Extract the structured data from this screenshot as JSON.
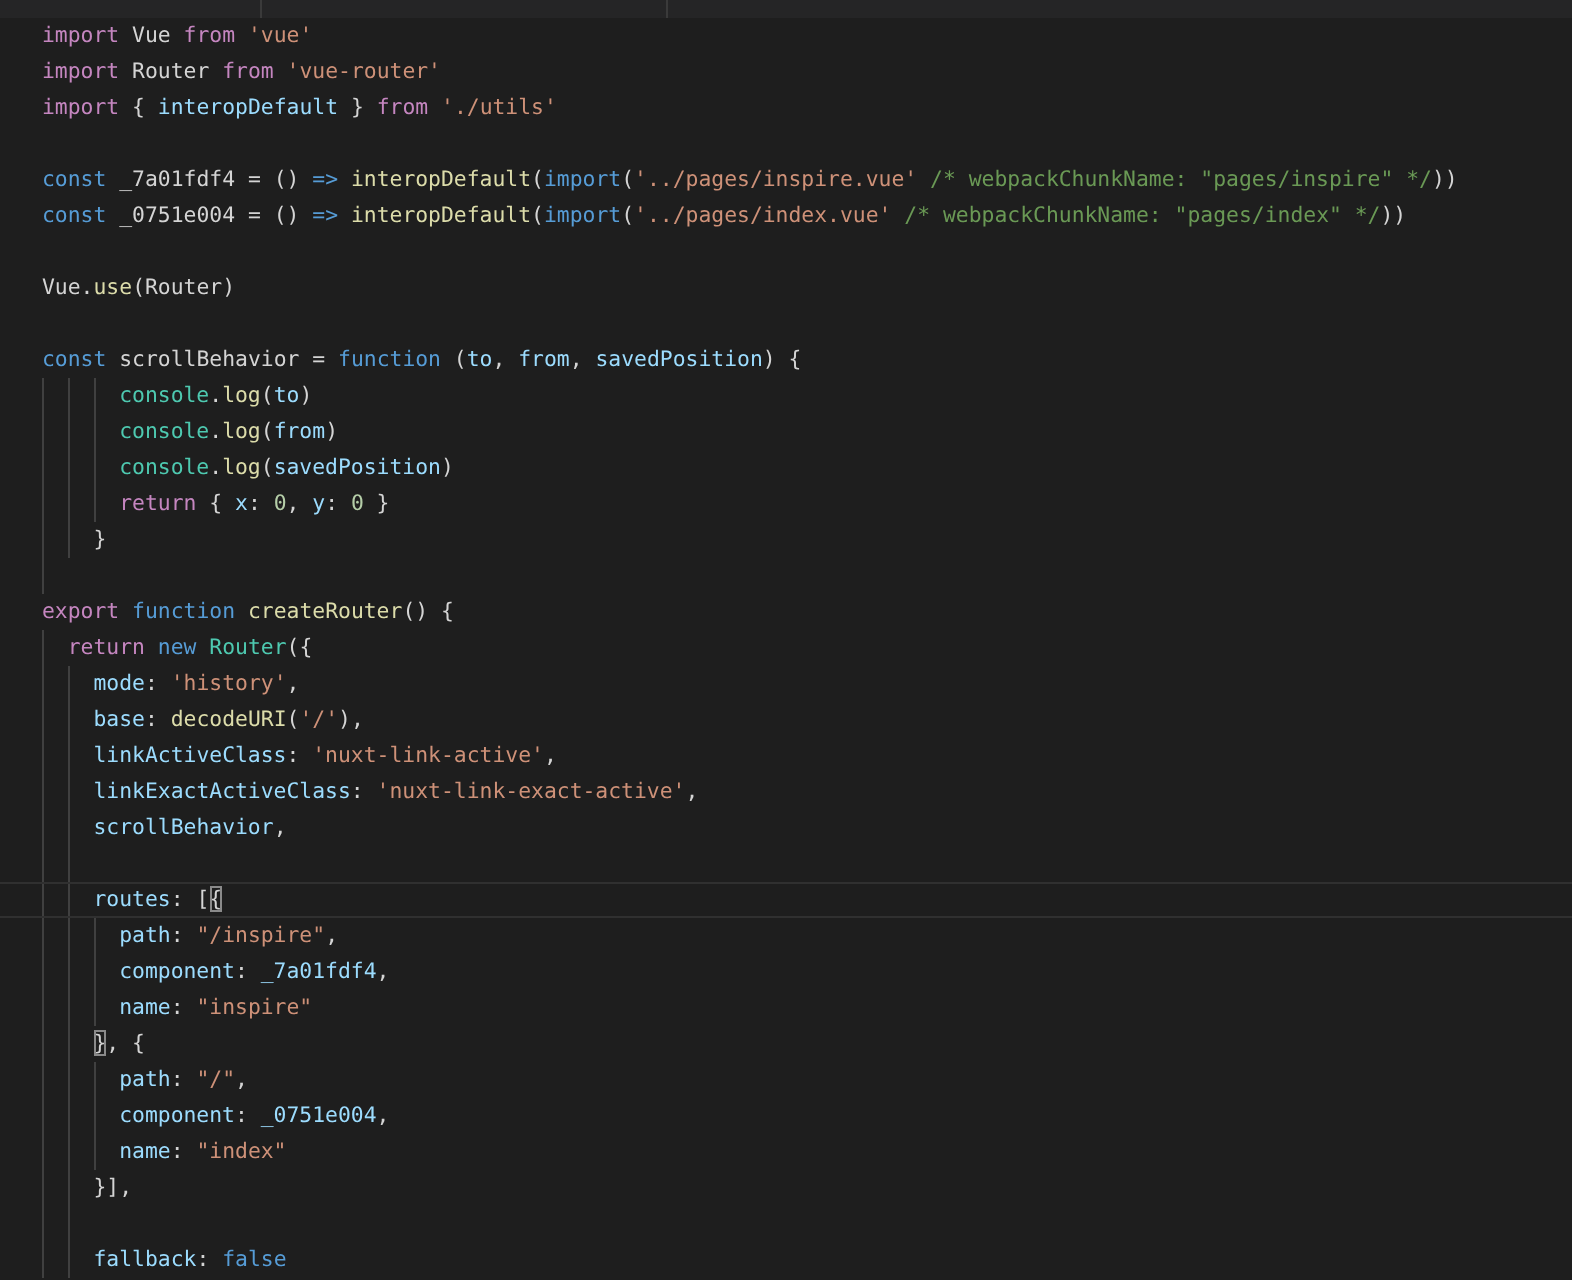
{
  "editor": {
    "lines": [
      {
        "kind": "flush",
        "current": false,
        "tokens": [
          {
            "t": "import",
            "kind": "keyword"
          },
          {
            "t": " Vue ",
            "kind": "plain"
          },
          {
            "t": "from",
            "kind": "keyword"
          },
          {
            "t": " 'vue'",
            "kind": "string"
          }
        ]
      },
      {
        "kind": "flush",
        "current": false,
        "tokens": [
          {
            "t": "import",
            "kind": "keyword"
          },
          {
            "t": " Router ",
            "kind": "plain"
          },
          {
            "t": "from",
            "kind": "keyword"
          },
          {
            "t": " 'vue-router'",
            "kind": "string"
          }
        ]
      },
      {
        "kind": "flush",
        "current": false,
        "tokens": [
          {
            "t": "import",
            "kind": "keyword"
          },
          {
            "t": " { ",
            "kind": "plain"
          },
          {
            "t": "interopDefault",
            "kind": "variable"
          },
          {
            "t": " } ",
            "kind": "plain"
          },
          {
            "t": "from",
            "kind": "keyword"
          },
          {
            "t": " './utils'",
            "kind": "string"
          }
        ]
      },
      {
        "kind": "flush",
        "current": false
      },
      {
        "kind": "flush",
        "current": false,
        "tokens": [
          {
            "t": "const",
            "kind": "storage"
          },
          {
            "t": " _7a01fdf4 = () ",
            "kind": "plain"
          },
          {
            "t": "=>",
            "kind": "storage"
          },
          {
            "t": " interopDefault",
            "kind": "function"
          },
          {
            "t": "(",
            "kind": "plain"
          },
          {
            "t": "import",
            "kind": "storage"
          },
          {
            "t": "(",
            "kind": "plain"
          },
          {
            "t": "'../pages/inspire.vue'",
            "kind": "string"
          },
          {
            "t": " /* webpackChunkName: \"pages/inspire\" */",
            "kind": "comment"
          },
          {
            "t": "))",
            "kind": "plain"
          }
        ]
      },
      {
        "kind": "flush",
        "current": false,
        "tokens": [
          {
            "t": "const",
            "kind": "storage"
          },
          {
            "t": " _0751e004 = () ",
            "kind": "plain"
          },
          {
            "t": "=>",
            "kind": "storage"
          },
          {
            "t": " interopDefault",
            "kind": "function"
          },
          {
            "t": "(",
            "kind": "plain"
          },
          {
            "t": "import",
            "kind": "storage"
          },
          {
            "t": "(",
            "kind": "plain"
          },
          {
            "t": "'../pages/index.vue'",
            "kind": "string"
          },
          {
            "t": " /* webpackChunkName: \"pages/index\" */",
            "kind": "comment"
          },
          {
            "t": "))",
            "kind": "plain"
          }
        ]
      },
      {
        "kind": "flush",
        "current": false
      },
      {
        "kind": "flush",
        "current": false,
        "tokens": [
          {
            "t": "Vue.",
            "kind": "plain"
          },
          {
            "t": "use",
            "kind": "function"
          },
          {
            "t": "(Router)",
            "kind": "plain"
          }
        ]
      },
      {
        "kind": "flush",
        "current": false
      },
      {
        "kind": "flush",
        "current": false,
        "tokens": [
          {
            "t": "const",
            "kind": "storage"
          },
          {
            "t": " scrollBehavior = ",
            "kind": "plain"
          },
          {
            "t": "function",
            "kind": "storage"
          },
          {
            "t": " (",
            "kind": "plain"
          },
          {
            "t": "to",
            "kind": "variable"
          },
          {
            "t": ", ",
            "kind": "plain"
          },
          {
            "t": "from",
            "kind": "variable"
          },
          {
            "t": ", ",
            "kind": "plain"
          },
          {
            "t": "savedPosition",
            "kind": "variable"
          },
          {
            "t": ") {",
            "kind": "plain"
          }
        ]
      },
      {
        "kind": "deep",
        "current": false,
        "tokens": [
          {
            "t": "console",
            "kind": "type"
          },
          {
            "t": ".",
            "kind": "plain"
          },
          {
            "t": "log",
            "kind": "function"
          },
          {
            "t": "(",
            "kind": "plain"
          },
          {
            "t": "to",
            "kind": "variable"
          },
          {
            "t": ")",
            "kind": "plain"
          }
        ]
      },
      {
        "kind": "deep",
        "current": false,
        "tokens": [
          {
            "t": "console",
            "kind": "type"
          },
          {
            "t": ".",
            "kind": "plain"
          },
          {
            "t": "log",
            "kind": "function"
          },
          {
            "t": "(",
            "kind": "plain"
          },
          {
            "t": "from",
            "kind": "variable"
          },
          {
            "t": ")",
            "kind": "plain"
          }
        ]
      },
      {
        "kind": "deep",
        "current": false,
        "tokens": [
          {
            "t": "console",
            "kind": "type"
          },
          {
            "t": ".",
            "kind": "plain"
          },
          {
            "t": "log",
            "kind": "function"
          },
          {
            "t": "(",
            "kind": "plain"
          },
          {
            "t": "savedPosition",
            "kind": "variable"
          },
          {
            "t": ")",
            "kind": "plain"
          }
        ]
      },
      {
        "kind": "deep",
        "current": false,
        "tokens": [
          {
            "t": "return",
            "kind": "keyword"
          },
          {
            "t": " { ",
            "kind": "plain"
          },
          {
            "t": "x",
            "kind": "variable"
          },
          {
            "t": ": ",
            "kind": "plain"
          },
          {
            "t": "0",
            "kind": "number"
          },
          {
            "t": ", ",
            "kind": "plain"
          },
          {
            "t": "y",
            "kind": "variable"
          },
          {
            "t": ": ",
            "kind": "plain"
          },
          {
            "t": "0",
            "kind": "number"
          },
          {
            "t": " }",
            "kind": "plain"
          }
        ]
      },
      {
        "kind": "middle",
        "current": false,
        "tokens": [
          {
            "t": "}",
            "kind": "plain"
          }
        ]
      },
      {
        "kind": "shallow",
        "current": false
      },
      {
        "kind": "flush",
        "current": false,
        "tokens": [
          {
            "t": "export",
            "kind": "keyword"
          },
          {
            "t": " function",
            "kind": "storage"
          },
          {
            "t": " createRouter",
            "kind": "function"
          },
          {
            "t": "() {",
            "kind": "plain"
          }
        ]
      },
      {
        "kind": "shallow",
        "current": false,
        "tokens": [
          {
            "t": "return",
            "kind": "keyword"
          },
          {
            "t": " new",
            "kind": "storage"
          },
          {
            "t": " Router",
            "kind": "type"
          },
          {
            "t": "({",
            "kind": "plain"
          }
        ]
      },
      {
        "kind": "middle",
        "current": false,
        "tokens": [
          {
            "t": "mode",
            "kind": "variable"
          },
          {
            "t": ": ",
            "kind": "plain"
          },
          {
            "t": "'history'",
            "kind": "string"
          },
          {
            "t": ",",
            "kind": "plain"
          }
        ]
      },
      {
        "kind": "middle",
        "current": false,
        "tokens": [
          {
            "t": "base",
            "kind": "variable"
          },
          {
            "t": ": ",
            "kind": "plain"
          },
          {
            "t": "decodeURI",
            "kind": "function"
          },
          {
            "t": "(",
            "kind": "plain"
          },
          {
            "t": "'/'",
            "kind": "string"
          },
          {
            "t": "),",
            "kind": "plain"
          }
        ]
      },
      {
        "kind": "middle",
        "current": false,
        "tokens": [
          {
            "t": "linkActiveClass",
            "kind": "variable"
          },
          {
            "t": ": ",
            "kind": "plain"
          },
          {
            "t": "'nuxt-link-active'",
            "kind": "string"
          },
          {
            "t": ",",
            "kind": "plain"
          }
        ]
      },
      {
        "kind": "middle",
        "current": false,
        "tokens": [
          {
            "t": "linkExactActiveClass",
            "kind": "variable"
          },
          {
            "t": ": ",
            "kind": "plain"
          },
          {
            "t": "'nuxt-link-exact-active'",
            "kind": "string"
          },
          {
            "t": ",",
            "kind": "plain"
          }
        ]
      },
      {
        "kind": "middle",
        "current": false,
        "tokens": [
          {
            "t": "scrollBehavior",
            "kind": "variable"
          },
          {
            "t": ",",
            "kind": "plain"
          }
        ]
      },
      {
        "kind": "middle",
        "current": false
      },
      {
        "kind": "middle",
        "current": true,
        "tokens": [
          {
            "t": "routes",
            "kind": "variable"
          },
          {
            "t": ": [",
            "kind": "plain"
          },
          {
            "t": "{",
            "kind": "bracket-match"
          }
        ]
      },
      {
        "kind": "deep",
        "current": false,
        "tokens": [
          {
            "t": "path",
            "kind": "variable"
          },
          {
            "t": ": ",
            "kind": "plain"
          },
          {
            "t": "\"/inspire\"",
            "kind": "string"
          },
          {
            "t": ",",
            "kind": "plain"
          }
        ]
      },
      {
        "kind": "deep",
        "current": false,
        "tokens": [
          {
            "t": "component",
            "kind": "variable"
          },
          {
            "t": ": ",
            "kind": "plain"
          },
          {
            "t": "_7a01fdf4",
            "kind": "variable"
          },
          {
            "t": ",",
            "kind": "plain"
          }
        ]
      },
      {
        "kind": "deep",
        "current": false,
        "tokens": [
          {
            "t": "name",
            "kind": "variable"
          },
          {
            "t": ": ",
            "kind": "plain"
          },
          {
            "t": "\"inspire\"",
            "kind": "string"
          }
        ]
      },
      {
        "kind": "middle",
        "current": false,
        "tokens": [
          {
            "t": "}",
            "kind": "bracket-match"
          },
          {
            "t": ", {",
            "kind": "plain"
          }
        ]
      },
      {
        "kind": "deep",
        "current": false,
        "tokens": [
          {
            "t": "path",
            "kind": "variable"
          },
          {
            "t": ": ",
            "kind": "plain"
          },
          {
            "t": "\"/\"",
            "kind": "string"
          },
          {
            "t": ",",
            "kind": "plain"
          }
        ]
      },
      {
        "kind": "deep",
        "current": false,
        "tokens": [
          {
            "t": "component",
            "kind": "variable"
          },
          {
            "t": ": ",
            "kind": "plain"
          },
          {
            "t": "_0751e004",
            "kind": "variable"
          },
          {
            "t": ",",
            "kind": "plain"
          }
        ]
      },
      {
        "kind": "deep",
        "current": false,
        "tokens": [
          {
            "t": "name",
            "kind": "variable"
          },
          {
            "t": ": ",
            "kind": "plain"
          },
          {
            "t": "\"index\"",
            "kind": "string"
          }
        ]
      },
      {
        "kind": "middle",
        "current": false,
        "tokens": [
          {
            "t": "}],",
            "kind": "plain"
          }
        ]
      },
      {
        "kind": "middle",
        "current": false
      },
      {
        "kind": "middle",
        "current": false,
        "tokens": [
          {
            "t": "fallback",
            "kind": "variable"
          },
          {
            "t": ": ",
            "kind": "plain"
          },
          {
            "t": "false",
            "kind": "storage"
          }
        ]
      }
    ]
  }
}
